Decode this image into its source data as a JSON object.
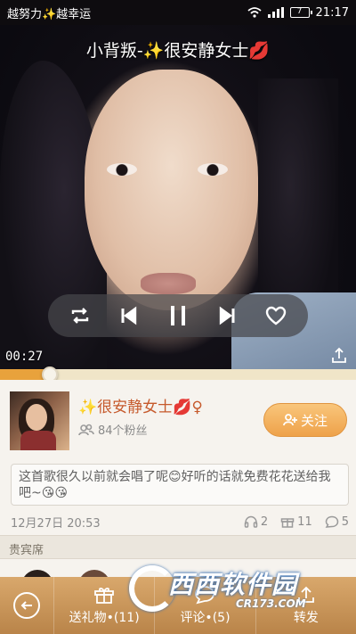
{
  "status_bar": {
    "carrier": "越努力✨越幸运",
    "battery": "7",
    "time": "21:17"
  },
  "player": {
    "song_title": "小背叛-✨很安静女士💋",
    "elapsed": "00:27",
    "progress": 0.14
  },
  "user": {
    "name": "✨很安静女士💋♀",
    "fans": "84个粉丝",
    "follow_label": "关注"
  },
  "post": {
    "description": "这首歌很久以前就会唱了呢😊好听的话就免费花花送给我吧~😘😘",
    "date": "12月27日 20:53",
    "listens": "2",
    "gifts": "11",
    "comments": "5"
  },
  "guests": {
    "header": "贵宾席"
  },
  "bottom_bar": {
    "gift_label": "送礼物•(11)",
    "comment_label": "评论•(5)",
    "share_label": "转发"
  },
  "watermark": {
    "text": "西西软件园",
    "subtext": "CR173.COM"
  },
  "colors": {
    "accent": "#e8a23c",
    "name": "#c65a2c",
    "bottom_bar": "#c99558"
  }
}
